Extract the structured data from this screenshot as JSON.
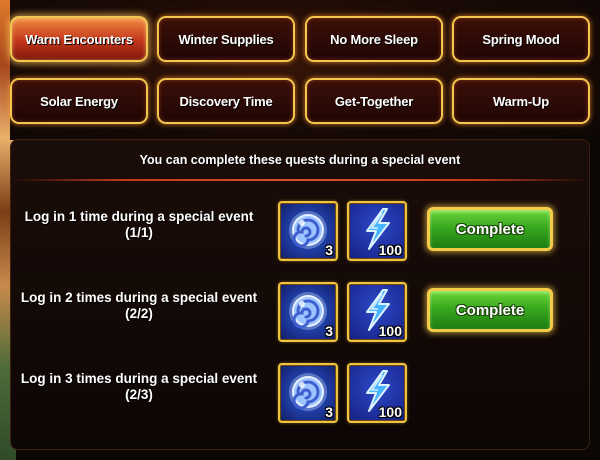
{
  "tabs": [
    {
      "label": "Warm Encounters",
      "active": true
    },
    {
      "label": "Winter Supplies",
      "active": false
    },
    {
      "label": "No More Sleep",
      "active": false
    },
    {
      "label": "Spring Mood",
      "active": false
    },
    {
      "label": "Solar Energy",
      "active": false
    },
    {
      "label": "Discovery Time",
      "active": false
    },
    {
      "label": "Get-Together",
      "active": false
    },
    {
      "label": "Warm-Up",
      "active": false
    }
  ],
  "panel": {
    "header": "You can complete these quests during a special event"
  },
  "quests": [
    {
      "title": "Log in 1 time during a special event",
      "progress": "(1/1)",
      "rewards": [
        {
          "icon": "swirl-orb-icon",
          "qty": "3"
        },
        {
          "icon": "energy-bolt-icon",
          "qty": "100"
        }
      ],
      "button": "Complete"
    },
    {
      "title": "Log in 2 times during a special event",
      "progress": "(2/2)",
      "rewards": [
        {
          "icon": "swirl-orb-icon",
          "qty": "3"
        },
        {
          "icon": "energy-bolt-icon",
          "qty": "100"
        }
      ],
      "button": "Complete"
    },
    {
      "title": "Log in 3 times during a special event",
      "progress": "(2/3)",
      "rewards": [
        {
          "icon": "swirl-orb-icon",
          "qty": "3"
        },
        {
          "icon": "energy-bolt-icon",
          "qty": "100"
        }
      ]
    }
  ],
  "colors": {
    "tab_border": "#f2c750",
    "active_tab": "#d8502a",
    "complete_green": "#39a81e",
    "reward_blue": "#1d2a8e",
    "panel_bg": "#150a06"
  }
}
